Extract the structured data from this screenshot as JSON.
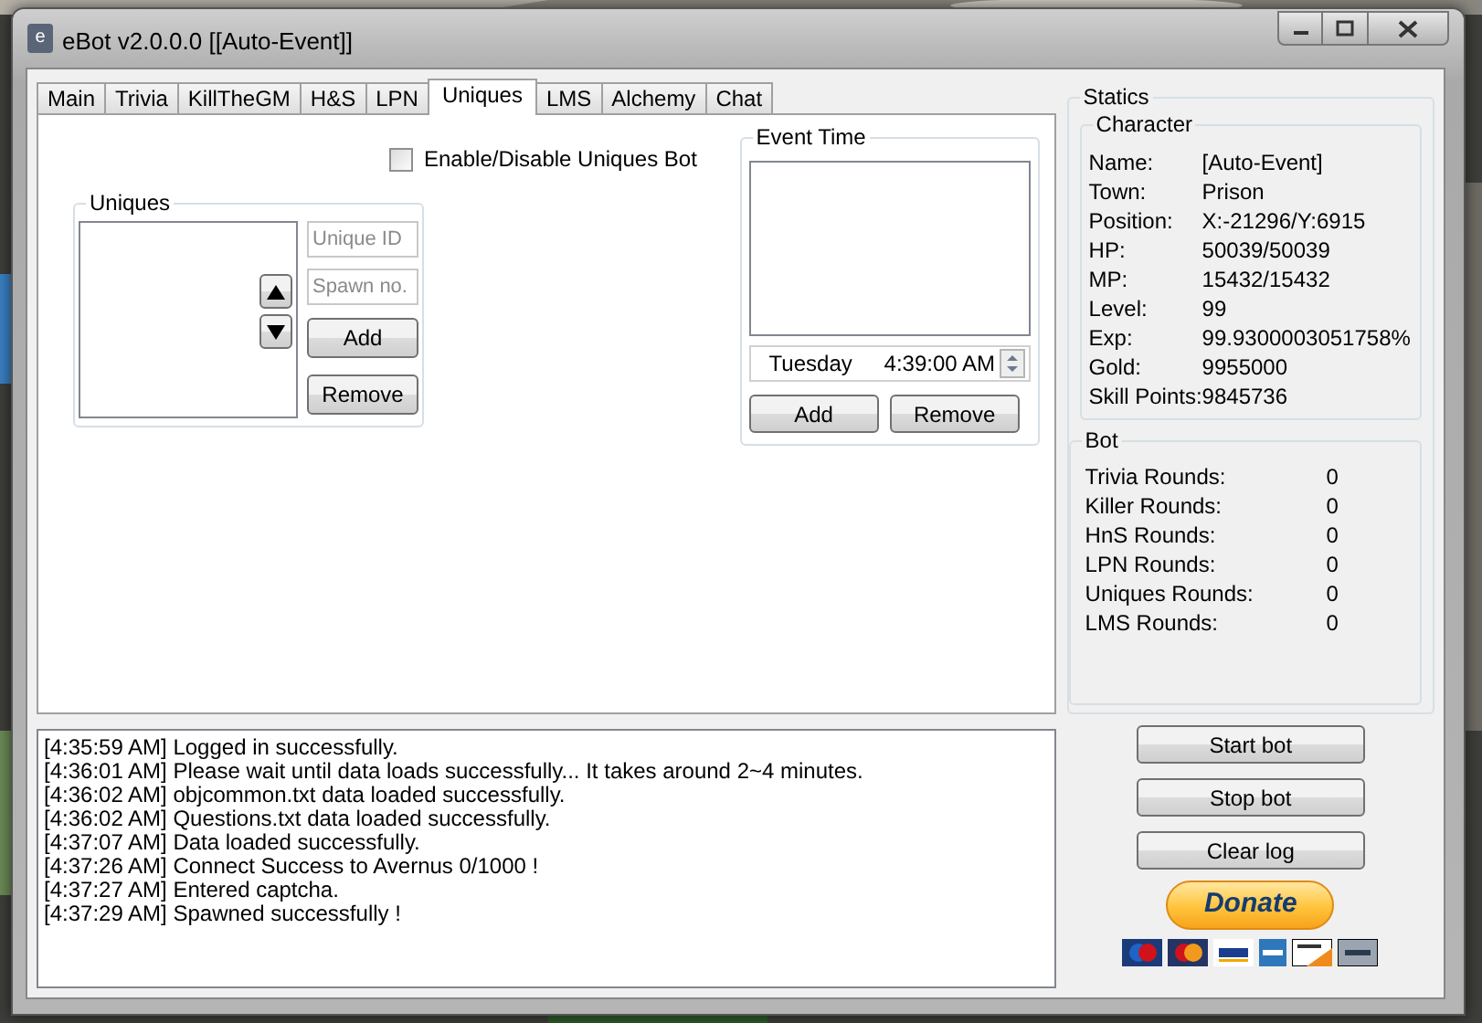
{
  "window": {
    "icon_letter": "e",
    "title": "eBot v2.0.0.0 [[Auto-Event]]"
  },
  "tabs": [
    {
      "label": "Main",
      "selected": false
    },
    {
      "label": "Trivia",
      "selected": false
    },
    {
      "label": "KillTheGM",
      "selected": false
    },
    {
      "label": "H&S",
      "selected": false
    },
    {
      "label": "LPN",
      "selected": false
    },
    {
      "label": "Uniques",
      "selected": true
    },
    {
      "label": "LMS",
      "selected": false
    },
    {
      "label": "Alchemy",
      "selected": false
    },
    {
      "label": "Chat",
      "selected": false
    }
  ],
  "uniques_tab": {
    "enable_checkbox": {
      "label": "Enable/Disable Uniques Bot",
      "checked": false
    },
    "uniques_group": {
      "title": "Uniques",
      "unique_id": {
        "placeholder": "Unique ID"
      },
      "spawn_no": {
        "placeholder": "Spawn no."
      },
      "buttons": [
        "Add",
        "Remove"
      ]
    },
    "event_time_group": {
      "title": "Event Time",
      "day": "Tuesday",
      "time": "4:39:00 AM",
      "buttons": [
        "Add",
        "Remove"
      ]
    }
  },
  "log": [
    "[4:35:59 AM] Logged in successfully.",
    "[4:36:01 AM] Please wait until data loads successfully... It takes around 2~4 minutes.",
    "[4:36:02 AM] objcommon.txt data loaded successfully.",
    "[4:36:02 AM] Questions.txt data loaded successfully.",
    "[4:37:07 AM] Data loaded successfully.",
    "[4:37:26 AM] Connect Success to Avernus 0/1000 !",
    "[4:37:27 AM] Entered captcha.",
    "[4:37:29 AM] Spawned successfully !"
  ],
  "statics": {
    "title": "Statics",
    "character": {
      "title": "Character",
      "fields": [
        {
          "label": "Name:",
          "value": "[Auto-Event]"
        },
        {
          "label": "Town:",
          "value": "Prison"
        },
        {
          "label": "Position:",
          "value": "X:-21296/Y:6915"
        },
        {
          "label": "HP:",
          "value": "50039/50039"
        },
        {
          "label": "MP:",
          "value": "15432/15432"
        },
        {
          "label": "Level:",
          "value": "99"
        },
        {
          "label": "Exp:",
          "value": "99.9300003051758%"
        },
        {
          "label": "Gold:",
          "value": "9955000"
        },
        {
          "label": "Skill Points:",
          "value": "9845736"
        }
      ]
    },
    "bot": {
      "title": "Bot",
      "fields": [
        {
          "label": "Trivia Rounds:",
          "value": "0"
        },
        {
          "label": "Killer Rounds:",
          "value": "0"
        },
        {
          "label": "HnS Rounds:",
          "value": "0"
        },
        {
          "label": "LPN Rounds:",
          "value": "0"
        },
        {
          "label": "Uniques Rounds:",
          "value": "0"
        },
        {
          "label": "LMS Rounds:",
          "value": "0"
        }
      ]
    }
  },
  "actions": [
    "Start bot",
    "Stop bot",
    "Clear log"
  ],
  "donate": {
    "label": "Donate"
  }
}
